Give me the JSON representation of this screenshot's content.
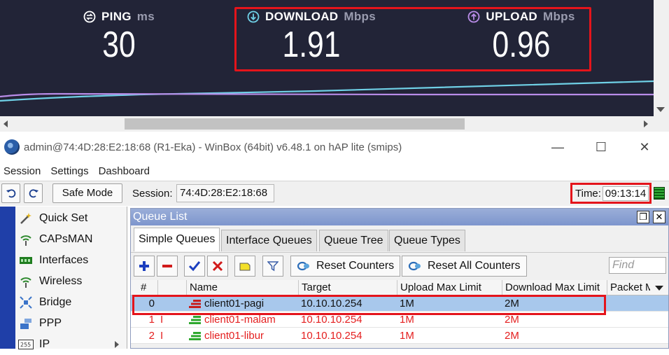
{
  "speedtest": {
    "ping": {
      "label": "PING",
      "unit": "ms",
      "value": "30"
    },
    "download": {
      "label": "DOWNLOAD",
      "unit": "Mbps",
      "value": "1.91"
    },
    "upload": {
      "label": "UPLOAD",
      "unit": "Mbps",
      "value": "0.96"
    },
    "colors": {
      "background": "#222437",
      "download": "#6fd0e6",
      "upload": "#b98ce8",
      "highlight": "#e4141b"
    }
  },
  "window": {
    "title": "admin@74:4D:28:E2:18:68 (R1-Eka) - WinBox (64bit) v6.48.1 on hAP lite (smips)",
    "controls": {
      "minimize": "—",
      "maximize": "☐",
      "close": "✕"
    }
  },
  "menu": [
    "Session",
    "Settings",
    "Dashboard"
  ],
  "toolbar": {
    "undo_icon": "undo-icon",
    "redo_icon": "redo-icon",
    "safe_mode": "Safe Mode",
    "session_label": "Session:",
    "session_value": "74:4D:28:E2:18:68",
    "time_label": "Time:",
    "time_value": "09:13:14"
  },
  "sidebar": {
    "items": [
      {
        "label": "Quick Set",
        "icon": "wand-icon"
      },
      {
        "label": "CAPsMAN",
        "icon": "wireless-icon"
      },
      {
        "label": "Interfaces",
        "icon": "interfaces-icon"
      },
      {
        "label": "Wireless",
        "icon": "wireless-icon"
      },
      {
        "label": "Bridge",
        "icon": "bridge-icon"
      },
      {
        "label": "PPP",
        "icon": "ppp-icon"
      },
      {
        "label": "IP",
        "icon": "ip-icon"
      }
    ]
  },
  "queue_list": {
    "title": "Queue List",
    "tabs": [
      "Simple Queues",
      "Interface Queues",
      "Queue Tree",
      "Queue Types"
    ],
    "active_tab": "Simple Queues",
    "buttons": {
      "reset_counters": "Reset Counters",
      "reset_all_counters": "Reset All Counters"
    },
    "find_placeholder": "Find",
    "columns": [
      "#",
      "",
      "Name",
      "Target",
      "Upload Max Limit",
      "Download Max Limit",
      "Packet M"
    ],
    "rows": [
      {
        "num": "0",
        "flag": "",
        "name": "client01-pagi",
        "target": "10.10.10.254",
        "upload": "1M",
        "download": "2M",
        "status": "active-selected"
      },
      {
        "num": "1",
        "flag": "I",
        "name": "client01-malam",
        "target": "10.10.10.254",
        "upload": "1M",
        "download": "2M",
        "status": "invalid"
      },
      {
        "num": "2",
        "flag": "I",
        "name": "client01-libur",
        "target": "10.10.10.254",
        "upload": "1M",
        "download": "2M",
        "status": "invalid"
      }
    ]
  }
}
